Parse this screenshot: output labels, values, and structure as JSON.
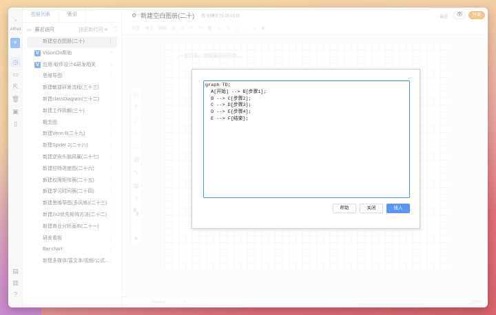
{
  "sidebar": {
    "user": "Alfred",
    "tabs": [
      "图册列表",
      "索引"
    ],
    "recent_label": "最近访问",
    "sort_label": "按更新时间 ≑",
    "items": [
      {
        "label": "新建空白图册(二十)",
        "selected": true
      },
      {
        "label": "VisionOn帮助",
        "icon": "V"
      },
      {
        "label": "应用-软件设计&研发相关",
        "icon": "V"
      },
      {
        "label": "思维导图"
      },
      {
        "label": "新建敏捷研发流程(三十三)"
      },
      {
        "label": "新建classDiagram(三十二)"
      },
      {
        "label": "新建工作拆解(三十)"
      },
      {
        "label": "概念图"
      },
      {
        "label": "新建Venn 6(二十九)"
      },
      {
        "label": "新建Spider 2(二十八)"
      },
      {
        "label": "新建逆向头脑风暴(二十七)"
      },
      {
        "label": "新建甘特进度图(二十六)"
      },
      {
        "label": "新建权限矩阵表(二十五)"
      },
      {
        "label": "新建学习时间表(二十四)"
      },
      {
        "label": "新建思维导图(多风格)(二十三)"
      },
      {
        "label": "新建2x2优先矩阵方法(二十二)"
      },
      {
        "label": "新建商业分析画布(二十一)"
      },
      {
        "label": "研发看板"
      },
      {
        "label": "Bar chart"
      },
      {
        "label": "新建多媒体/富文本/视频/公式..."
      }
    ]
  },
  "header": {
    "title": "新建空白图册(二十)",
    "meta": "我 创建于23-05-05日",
    "recent": "最近:",
    "share": "分享"
  },
  "toolbar": {
    "labels": "形状 格式 模板"
  },
  "canvas": {
    "hint": "一张白纸，就是最好的开始。"
  },
  "footer": {
    "page": "Page-1",
    "zoom": "100%"
  },
  "dialog": {
    "code": "graph TD;\n  A[开始] --> B[步骤1];\n  B --> C[步骤2];\n  C --> D[步骤3];\n  D --> E[步骤4];\n  E --> F[结束];",
    "help": "帮助",
    "close": "关闭",
    "insert": "插入"
  }
}
